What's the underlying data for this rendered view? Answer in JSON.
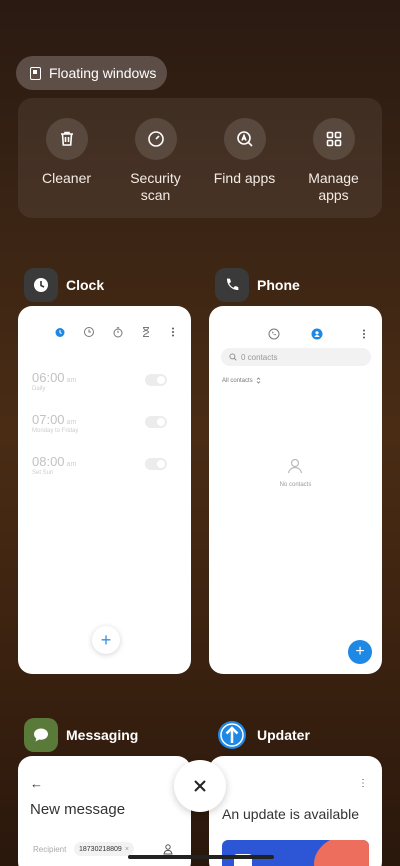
{
  "floating_windows": {
    "label": "Floating windows"
  },
  "tools": [
    {
      "label": "Cleaner",
      "icon": "trash-icon"
    },
    {
      "label": "Security scan",
      "icon": "security-gauge-icon"
    },
    {
      "label": "Find apps",
      "icon": "find-apps-icon"
    },
    {
      "label": "Manage apps",
      "icon": "grid-icon"
    }
  ],
  "apps": {
    "clock": {
      "name": "Clock",
      "alarms": [
        {
          "time": "06:00",
          "ampm": "am",
          "repeat": "Daily"
        },
        {
          "time": "07:00",
          "ampm": "am",
          "repeat": "Monday to Friday"
        },
        {
          "time": "08:00",
          "ampm": "am",
          "repeat": "Set Sun"
        }
      ],
      "fab": "+"
    },
    "phone": {
      "name": "Phone",
      "search_placeholder": "0 contacts",
      "filter": "All contacts",
      "empty": "No contacts",
      "fab": "+"
    },
    "messaging": {
      "name": "Messaging",
      "back": "←",
      "title": "New message",
      "recipient_label": "Recipient",
      "recipient_chip": "18730218809"
    },
    "updater": {
      "name": "Updater",
      "title": "An update is available",
      "more": "⋮"
    }
  },
  "colors": {
    "accent_blue": "#1e88e5",
    "clock_icon_bg": "#3a3a3a",
    "messaging_icon_bg": "#5a7a3a",
    "updater_icon_bg": "#1e88e5"
  }
}
